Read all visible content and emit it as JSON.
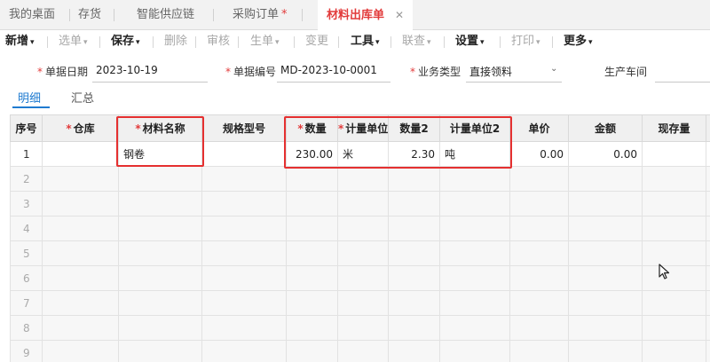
{
  "tabs": [
    {
      "label": "我的桌面"
    },
    {
      "label": "存货"
    },
    {
      "label": "智能供应链"
    },
    {
      "label": "采购订单",
      "dirty_mark": "*"
    },
    {
      "label": "材料出库单",
      "close": "✕"
    }
  ],
  "toolbar": {
    "items": [
      {
        "label": "新增",
        "caret": "▾"
      },
      {
        "label": "选单",
        "caret": "▾"
      },
      {
        "label": "保存",
        "caret": "▾"
      },
      {
        "label": "删除"
      },
      {
        "label": "审核"
      },
      {
        "label": "生单",
        "caret": "▾"
      },
      {
        "label": "变更"
      },
      {
        "label": "工具",
        "caret": "▾"
      },
      {
        "label": "联查",
        "caret": "▾"
      },
      {
        "label": "设置",
        "caret": "▾"
      },
      {
        "label": "打印",
        "caret": "▾"
      },
      {
        "label": "更多",
        "caret": "▾"
      }
    ]
  },
  "form": {
    "required_mark": "*",
    "date_label": "单据日期",
    "date_value": "2023-10-19",
    "number_label": "单据编号",
    "number_value": "MD-2023-10-0001",
    "biztype_label": "业务类型",
    "biztype_value": "直接领料",
    "biztype_caret": "⌄",
    "workshop_label": "生产车间"
  },
  "subtabs": [
    {
      "label": "明细"
    },
    {
      "label": "汇总"
    }
  ],
  "grid": {
    "headers": [
      "序号",
      "仓库",
      "材料名称",
      "规格型号",
      "数量",
      "计量单位",
      "数量2",
      "计量单位2",
      "单价",
      "金额",
      "现存量"
    ],
    "row1": {
      "index": "1",
      "warehouse": "",
      "material": "钢卷",
      "spec": "",
      "qty": "230.00",
      "unit": "米",
      "qty2": "2.30",
      "unit2": "吨",
      "price": "0.00",
      "amount": "0.00",
      "stock": ""
    },
    "empty_rows": [
      "2",
      "3",
      "4",
      "5",
      "6",
      "7",
      "8",
      "9"
    ]
  }
}
